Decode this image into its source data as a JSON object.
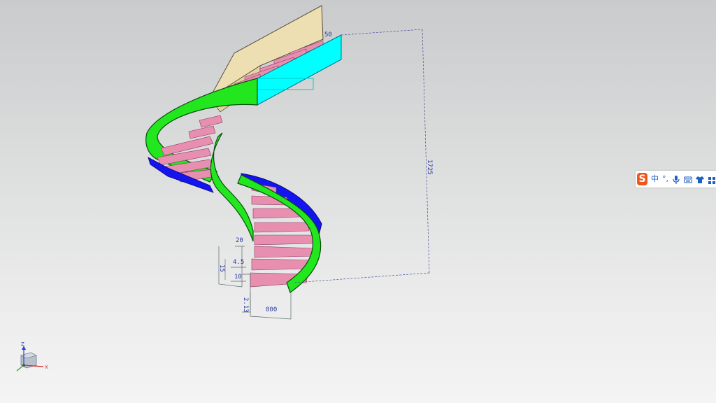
{
  "dimensions": {
    "top": "50",
    "height": "1725",
    "top_left": "20",
    "rise": "15",
    "tread_label": "4.5",
    "thickness": "10",
    "first_step": "2.13",
    "width": "800"
  },
  "ime_toolbar": {
    "logo": "S",
    "mode_label": "中",
    "punctuation_label": "°,"
  },
  "axis": {
    "z": "Z",
    "x": "X"
  },
  "colors": {
    "background": "#dcdddd",
    "treads": "#e88fb0",
    "outer_stringer": "#22e61e",
    "inner_stringer": "#1414f0",
    "landing_face": "#00ffff",
    "wall": "#eedfb2",
    "dimension": "#3344aa"
  },
  "icons": {
    "mic": "microphone-icon",
    "keyboard": "keyboard-icon",
    "shirt": "skin-icon",
    "more": "grid-icon"
  }
}
